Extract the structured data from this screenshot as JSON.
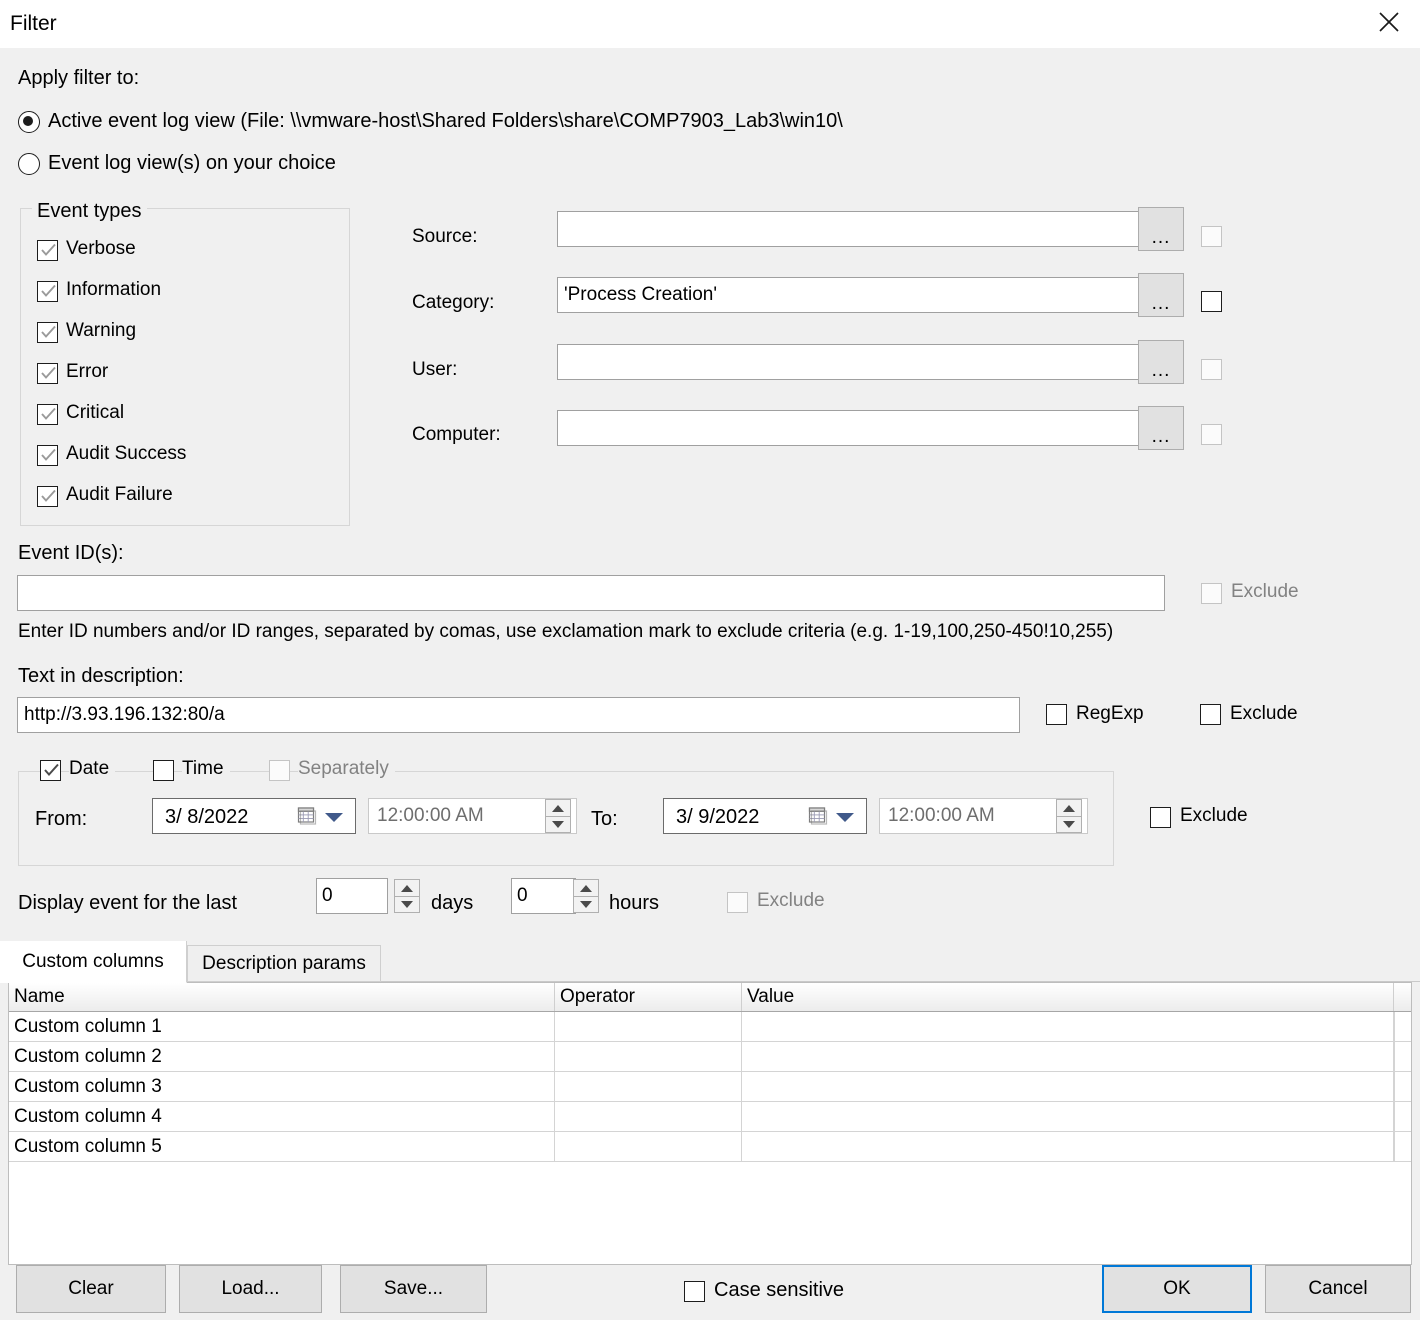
{
  "window": {
    "title": "Filter",
    "close_icon": "close-icon"
  },
  "apply_filter": {
    "label": "Apply filter to:",
    "options": [
      {
        "label": "Active event log view (File: \\\\vmware-host\\Shared Folders\\share\\COMP7903_Lab3\\win10\\",
        "selected": true
      },
      {
        "label": "Event log view(s) on your choice",
        "selected": false
      }
    ]
  },
  "event_types": {
    "title": "Event types",
    "items": [
      {
        "label": "Verbose",
        "checked": true
      },
      {
        "label": "Information",
        "checked": true
      },
      {
        "label": "Warning",
        "checked": true
      },
      {
        "label": "Error",
        "checked": true
      },
      {
        "label": "Critical",
        "checked": true
      },
      {
        "label": "Audit Success",
        "checked": true
      },
      {
        "label": "Audit Failure",
        "checked": true
      }
    ]
  },
  "criteria": {
    "browse_label": "...",
    "exclude_label": "Exclude",
    "rows": [
      {
        "label": "Source:",
        "value": "",
        "exclude_checked": false,
        "exclude_enabled": false
      },
      {
        "label": "Category:",
        "value": "'Process Creation'",
        "exclude_checked": false,
        "exclude_enabled": true
      },
      {
        "label": "User:",
        "value": "",
        "exclude_checked": false,
        "exclude_enabled": false
      },
      {
        "label": "Computer:",
        "value": "",
        "exclude_checked": false,
        "exclude_enabled": false
      }
    ]
  },
  "event_ids": {
    "label": "Event ID(s):",
    "value": "",
    "exclude_label": "Exclude",
    "exclude_enabled": false,
    "hint": "Enter ID numbers and/or ID ranges, separated by comas, use exclamation mark to exclude criteria (e.g. 1-19,100,250-450!10,255)"
  },
  "description": {
    "label": "Text in description:",
    "value": "http://3.93.196.132:80/a",
    "regexp_label": "RegExp",
    "regexp_checked": false,
    "exclude_label": "Exclude",
    "exclude_checked": false
  },
  "datetime": {
    "date_label": "Date",
    "date_checked": true,
    "time_label": "Time",
    "time_checked": false,
    "separately_label": "Separately",
    "separately_checked": false,
    "separately_enabled": false,
    "from_label": "From:",
    "from_date": "3/  8/2022",
    "from_time": "12:00:00 AM",
    "to_label": "To:",
    "to_date": "3/  9/2022",
    "to_time": "12:00:00 AM",
    "exclude_label": "Exclude",
    "exclude_checked": false
  },
  "last_period": {
    "label": "Display event for the last",
    "days_value": "0",
    "days_label": "days",
    "hours_value": "0",
    "hours_label": "hours",
    "exclude_label": "Exclude",
    "exclude_enabled": false
  },
  "tabs": [
    {
      "label": "Custom columns",
      "active": true
    },
    {
      "label": "Description params",
      "active": false
    }
  ],
  "grid": {
    "headers": [
      "Name",
      "Operator",
      "Value",
      ""
    ],
    "rows": [
      {
        "name": "Custom column 1",
        "operator": "",
        "value": ""
      },
      {
        "name": "Custom column 2",
        "operator": "",
        "value": ""
      },
      {
        "name": "Custom column 3",
        "operator": "",
        "value": ""
      },
      {
        "name": "Custom column 4",
        "operator": "",
        "value": ""
      },
      {
        "name": "Custom column 5",
        "operator": "",
        "value": ""
      }
    ]
  },
  "footer": {
    "clear_label": "Clear",
    "load_label": "Load...",
    "save_label": "Save...",
    "case_sensitive_label": "Case sensitive",
    "case_sensitive_checked": false,
    "ok_label": "OK",
    "cancel_label": "Cancel"
  },
  "colors": {
    "dialog_bg": "#f0f0f0",
    "focus_blue": "#0078d7",
    "disabled_text": "#828282",
    "check_grey": "#9a9a9a",
    "check_black": "#6d6d6d"
  }
}
